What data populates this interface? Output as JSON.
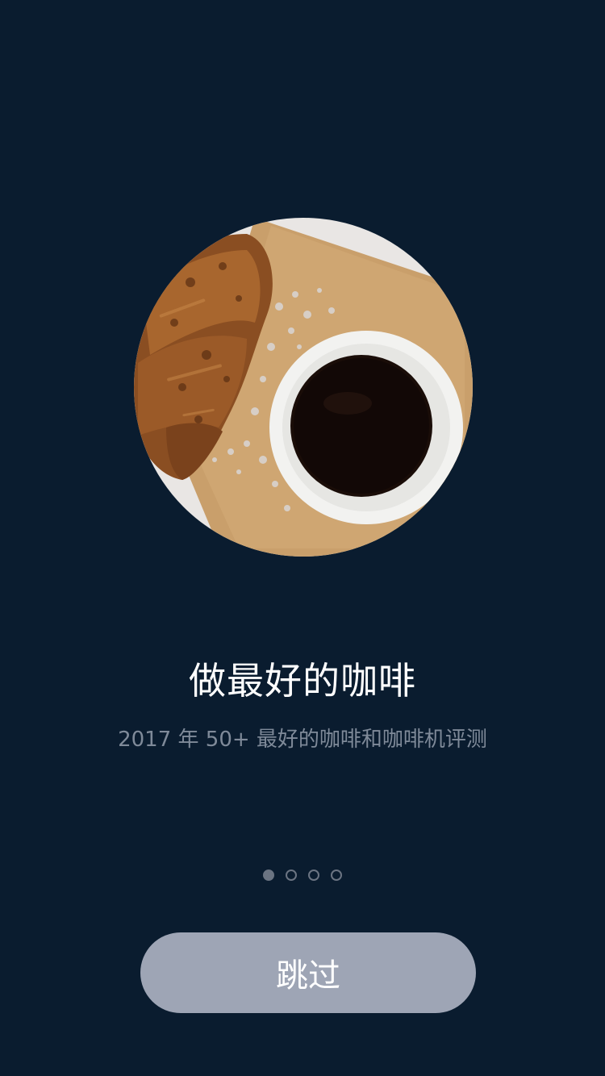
{
  "onboarding": {
    "title": "做最好的咖啡",
    "subtitle": "2017 年 50+ 最好的咖啡和咖啡机评测",
    "skip_label": "跳过",
    "page_indicator": {
      "total": 4,
      "active_index": 0
    }
  },
  "colors": {
    "background": "#0a1c2f",
    "title": "#ffffff",
    "subtitle": "#7f8a99",
    "button_bg": "#9ea5b5",
    "dot": "#6b7482"
  }
}
